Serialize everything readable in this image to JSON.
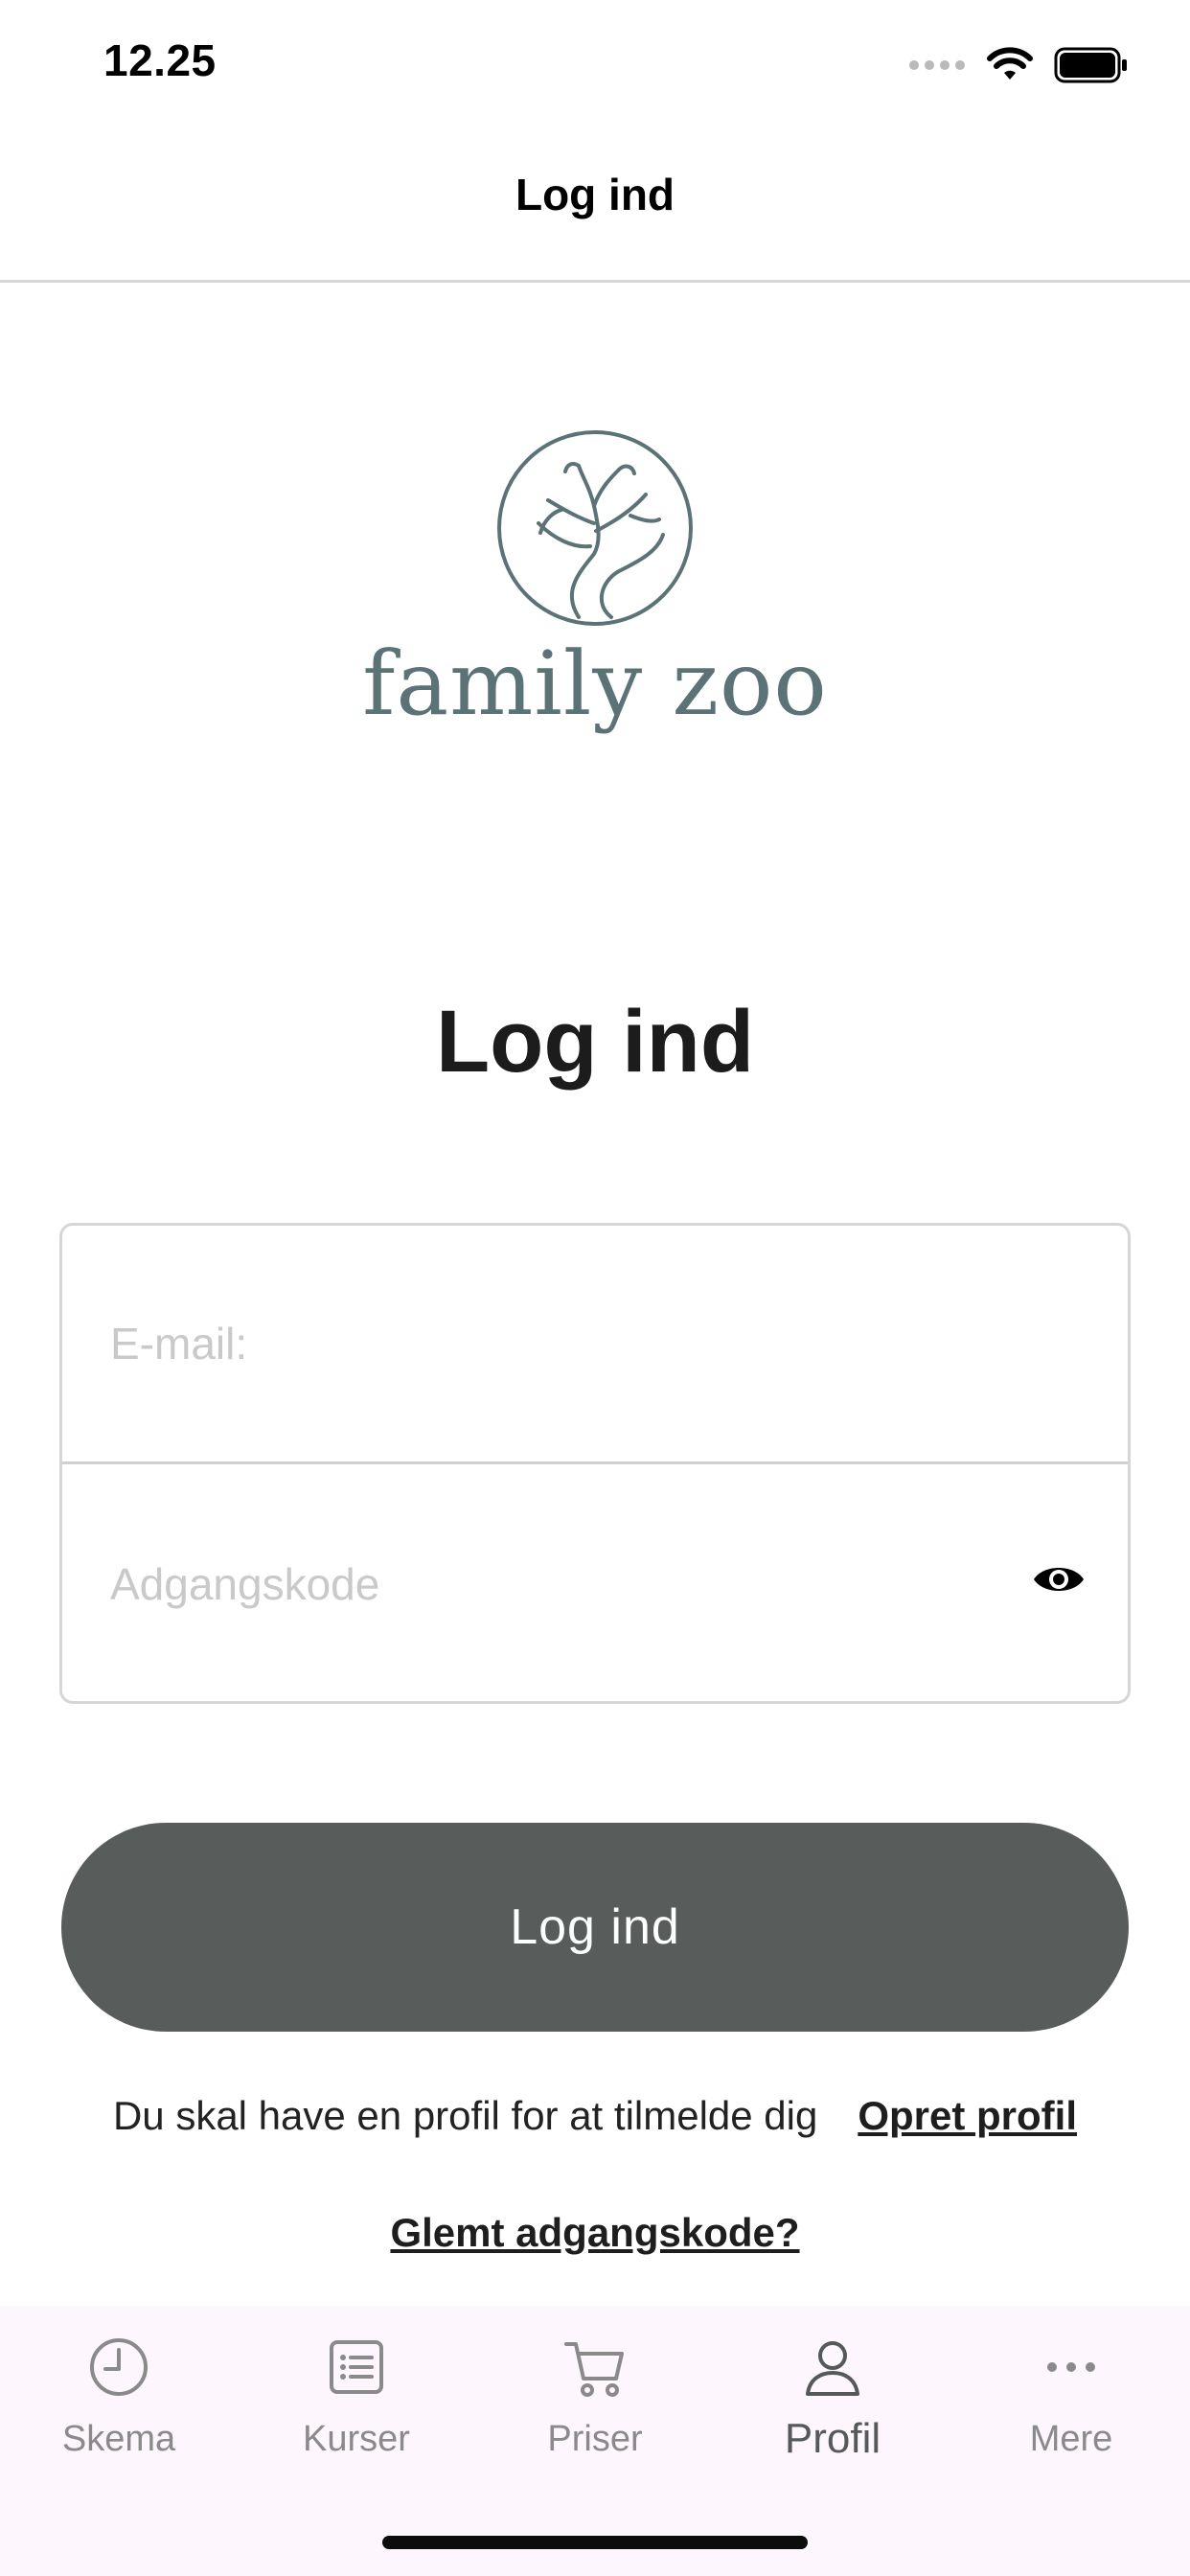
{
  "status_bar": {
    "time": "12.25",
    "icons": [
      "signal-dots-icon",
      "wifi-icon",
      "battery-icon"
    ]
  },
  "nav": {
    "title": "Log ind"
  },
  "logo": {
    "icon": "tree-logo-icon",
    "text": "family zoo",
    "color": "#5b7276"
  },
  "heading": "Log ind",
  "form": {
    "email_placeholder": "E-mail:",
    "email_value": "",
    "password_placeholder": "Adgangskode",
    "password_value": "",
    "password_toggle_icon": "eye-icon"
  },
  "login_button": {
    "label": "Log ind",
    "color": "#585d5c"
  },
  "register": {
    "prompt": "Du skal have en profil for at tilmelde dig",
    "link": "Opret profil"
  },
  "forgot_password": "Glemt adgangskode?",
  "tab_bar": {
    "background": "#fdf6fc",
    "active_tab": "Profil",
    "tabs": [
      {
        "label": "Skema",
        "icon": "clock-icon"
      },
      {
        "label": "Kurser",
        "icon": "list-icon"
      },
      {
        "label": "Priser",
        "icon": "cart-icon"
      },
      {
        "label": "Profil",
        "icon": "person-icon"
      },
      {
        "label": "Mere",
        "icon": "more-dots-icon"
      }
    ]
  }
}
